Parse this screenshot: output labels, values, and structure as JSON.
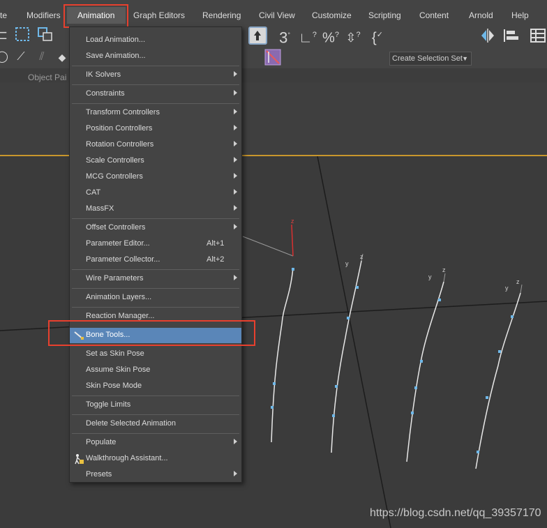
{
  "menubar": {
    "items": [
      "te",
      "Modifiers",
      "Animation",
      "Graph Editors",
      "Rendering",
      "Civil View",
      "Customize",
      "Scripting",
      "Content",
      "Arnold",
      "Help"
    ],
    "active_index": 2
  },
  "toolbar": {
    "selection_set": "Create Selection Set"
  },
  "ribbon": {
    "label": "Object Pai"
  },
  "dropdown": {
    "items": [
      {
        "label": "Load Animation..."
      },
      {
        "label": "Save Animation..."
      },
      {
        "label": "IK Solvers",
        "submenu": true
      },
      {
        "label": "Constraints",
        "submenu": true
      },
      {
        "label": "Transform Controllers",
        "submenu": true
      },
      {
        "label": "Position Controllers",
        "submenu": true
      },
      {
        "label": "Rotation Controllers",
        "submenu": true
      },
      {
        "label": "Scale Controllers",
        "submenu": true
      },
      {
        "label": "MCG Controllers",
        "submenu": true
      },
      {
        "label": "CAT",
        "submenu": true
      },
      {
        "label": "MassFX",
        "submenu": true
      },
      {
        "label": "Offset Controllers",
        "submenu": true
      },
      {
        "label": "Parameter Editor...",
        "shortcut": "Alt+1"
      },
      {
        "label": "Parameter Collector...",
        "shortcut": "Alt+2"
      },
      {
        "label": "Wire Parameters",
        "submenu": true
      },
      {
        "label": "Animation Layers..."
      },
      {
        "label": "Reaction Manager..."
      },
      {
        "label": "Bone Tools...",
        "selected": true
      },
      {
        "label": "Set as Skin Pose"
      },
      {
        "label": "Assume Skin Pose"
      },
      {
        "label": "Skin Pose Mode"
      },
      {
        "label": "Toggle Limits"
      },
      {
        "label": "Delete Selected Animation"
      },
      {
        "label": "Populate",
        "submenu": true
      },
      {
        "label": "Walkthrough Assistant..."
      },
      {
        "label": "Presets",
        "submenu": true
      }
    ]
  },
  "viewport": {
    "axis_labels": [
      "z",
      "y",
      "z",
      "y",
      "z",
      "y",
      "z"
    ]
  },
  "watermark": "https://blog.csdn.net/qq_39357170",
  "colors": {
    "highlight_box": "#e8402e",
    "selected_item": "#5a86b8",
    "viewport_border": "#c8962c"
  }
}
